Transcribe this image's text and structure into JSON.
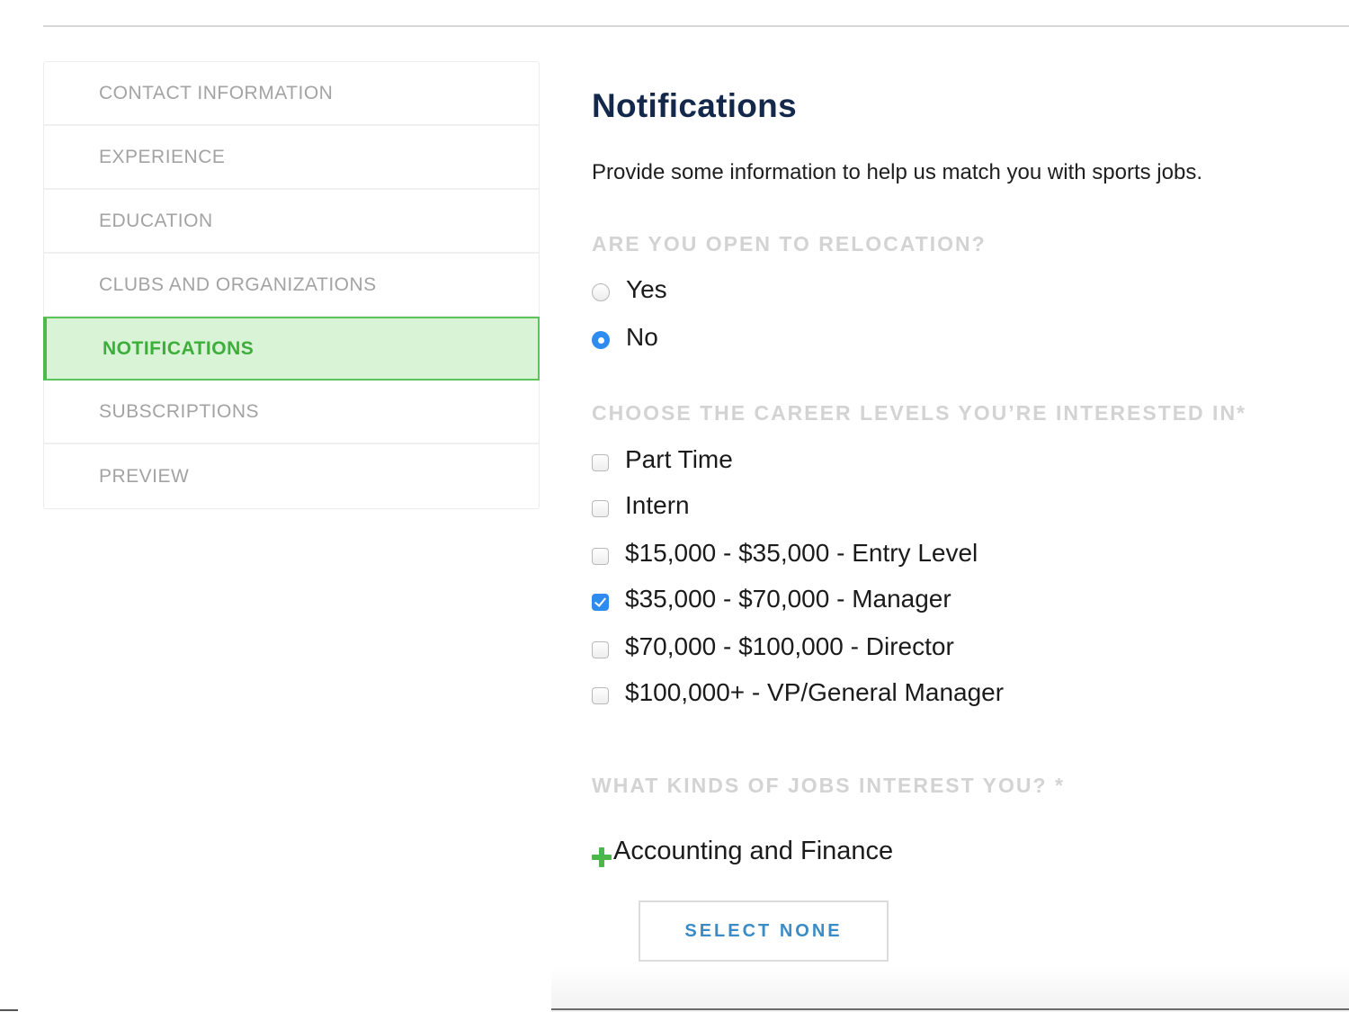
{
  "sidebar": {
    "items": [
      {
        "label": "CONTACT INFORMATION",
        "active": false
      },
      {
        "label": "EXPERIENCE",
        "active": false
      },
      {
        "label": "EDUCATION",
        "active": false
      },
      {
        "label": "CLUBS AND ORGANIZATIONS",
        "active": false
      },
      {
        "label": "NOTIFICATIONS",
        "active": true
      },
      {
        "label": "SUBSCRIPTIONS",
        "active": false
      },
      {
        "label": "PREVIEW",
        "active": false
      }
    ]
  },
  "main": {
    "title": "Notifications",
    "description": "Provide some information to help us match you with sports jobs.",
    "relocation": {
      "label": "ARE YOU OPEN TO RELOCATION?",
      "options": [
        {
          "label": "Yes",
          "checked": false
        },
        {
          "label": "No",
          "checked": true
        }
      ]
    },
    "career_levels": {
      "label": "CHOOSE THE CAREER LEVELS YOU’RE INTERESTED IN*",
      "options": [
        {
          "label": "Part Time",
          "checked": false
        },
        {
          "label": "Intern",
          "checked": false
        },
        {
          "label": "$15,000 - $35,000 - Entry Level",
          "checked": false
        },
        {
          "label": "$35,000 - $70,000 - Manager",
          "checked": true
        },
        {
          "label": "$70,000 - $100,000 - Director",
          "checked": false
        },
        {
          "label": "$100,000+ - VP/General Manager",
          "checked": false
        }
      ]
    },
    "job_kinds": {
      "label": "WHAT KINDS OF JOBS INTEREST YOU? *",
      "categories": [
        {
          "label": "Accounting and Finance",
          "icon": "plus-icon"
        }
      ]
    },
    "select_none_label": "SELECT NONE"
  },
  "colors": {
    "accent_green": "#4db84b",
    "active_bg": "#d8f3d6",
    "checked_blue": "#2e8bf0",
    "title_navy": "#14284b",
    "button_text_blue": "#3b8cc6"
  }
}
